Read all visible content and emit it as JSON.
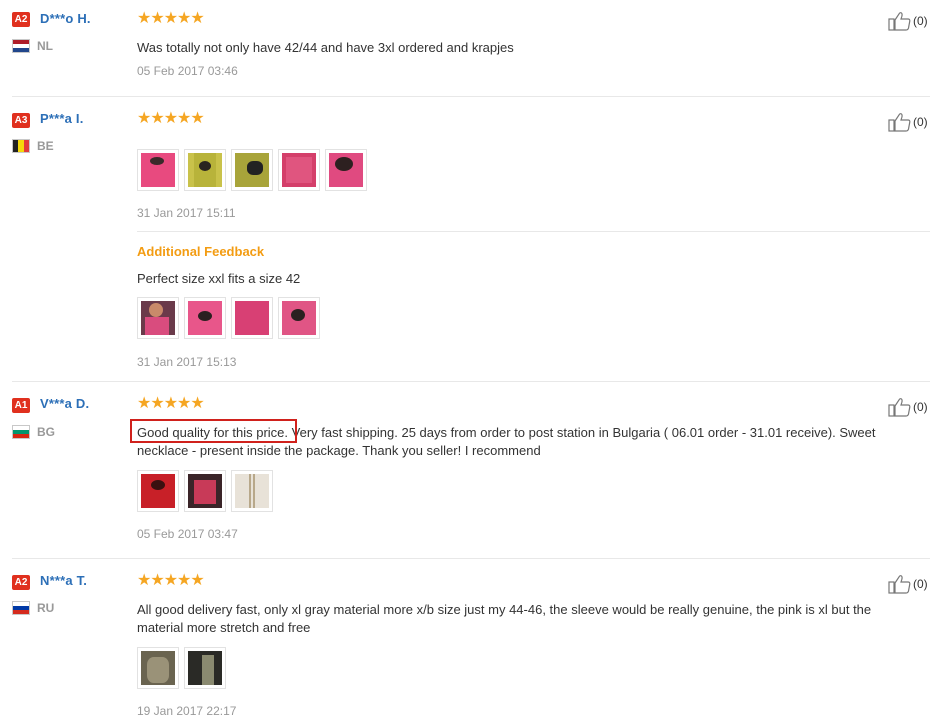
{
  "reviews": [
    {
      "badge": "A2",
      "badge_color": "#e0301e",
      "name": "D***o H.",
      "country": "NL",
      "stars": "★★★★★",
      "rating": 5,
      "likes": "(0)",
      "text": "Was totally not only have 42/44 and have 3xl ordered and krapjes",
      "date": "05 Feb 2017 03:46"
    },
    {
      "badge": "A3",
      "badge_color": "#e0301e",
      "name": "P***a I.",
      "country": "BE",
      "stars": "★★★★★",
      "rating": 5,
      "likes": "(0)",
      "photos": [
        "pink-shirt",
        "yellow-shirt",
        "olive-shirt",
        "pink-shirt-2",
        "pink-shirt-3"
      ],
      "date": "31 Jan 2017 15:11",
      "additional": {
        "heading": "Additional Feedback",
        "text": "Perfect size xxl fits a size 42",
        "photos": [
          "person-photo",
          "pink-shirt-heart",
          "pink-shirt-plain",
          "pink-shirt-heart-2"
        ],
        "date": "31 Jan 2017 15:13"
      }
    },
    {
      "badge": "A1",
      "badge_color": "#e0301e",
      "name": "V***a D.",
      "country": "BG",
      "stars": "★★★★★",
      "rating": 5,
      "likes": "(0)",
      "text_highlight": "Good quality for this price.",
      "text_line1_rest": " Very fast shipping. 25 days from order to post station in Bulgaria ( 06.01 order - 31.01 receive). Sweet",
      "text_line2": "necklace - present inside the package. Thank you seller! I recommend",
      "photos": [
        "red-shirt",
        "dark-shirt",
        "necklace"
      ],
      "date": "05 Feb 2017 03:47"
    },
    {
      "badge": "A2",
      "badge_color": "#e0301e",
      "name": "N***a T.",
      "country": "RU",
      "stars": "★★★★★",
      "rating": 5,
      "likes": "(0)",
      "text_line1": "All good delivery fast, only xl gray material more x/b size just my 44-46, the sleeve would be really genuine, the pink is xl but the",
      "text_line2": "material more stretch and free",
      "photos": [
        "gray-shirt",
        "black-shirt"
      ],
      "date": "19 Jan 2017 22:17"
    }
  ],
  "colors": {
    "username": "#2c6fb7",
    "star": "#f5a623",
    "additional_heading": "#f39c12",
    "highlight_box": "#d0211c",
    "date": "#999999"
  },
  "icons": [
    "thumbs-up-icon",
    "flag-icon",
    "star-icon"
  ]
}
